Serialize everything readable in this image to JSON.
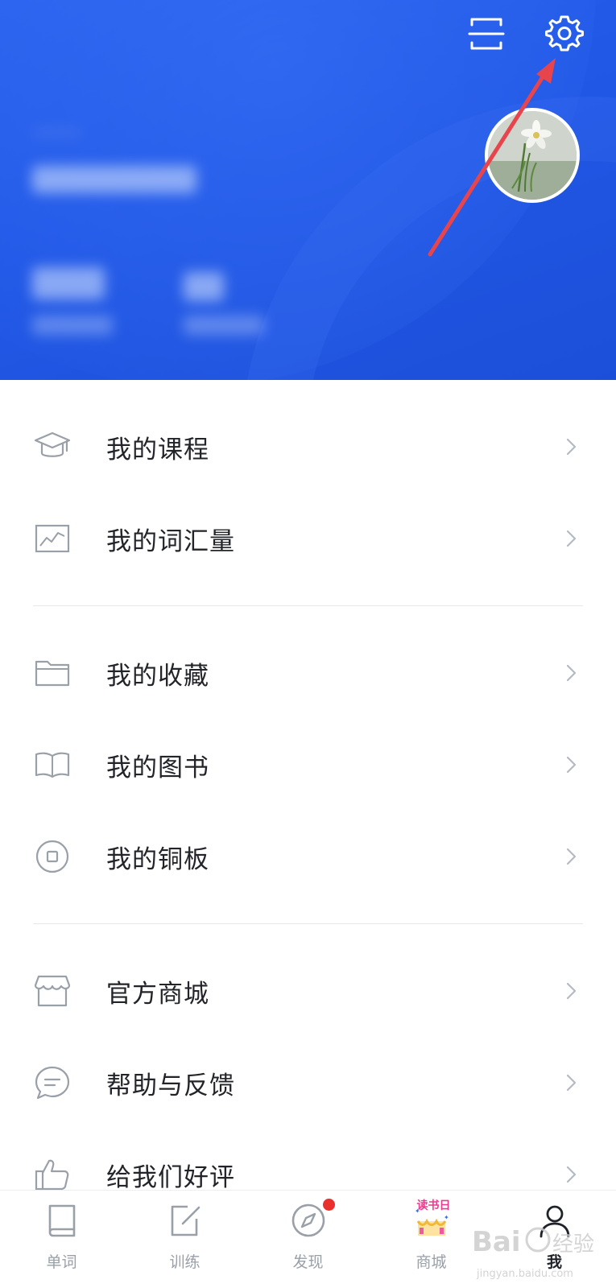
{
  "header": {
    "scan_icon": "scan-icon",
    "settings_icon": "settings-gear-icon",
    "user_name": "·····",
    "avatar_icon": "avatar-flower-photo"
  },
  "menu": {
    "groups": [
      {
        "items": [
          {
            "label": "我的课程",
            "icon": "graduation-cap-icon"
          },
          {
            "label": "我的词汇量",
            "icon": "chart-icon"
          }
        ]
      },
      {
        "items": [
          {
            "label": "我的收藏",
            "icon": "folder-icon"
          },
          {
            "label": "我的图书",
            "icon": "open-book-icon"
          },
          {
            "label": "我的铜板",
            "icon": "coin-icon"
          }
        ]
      },
      {
        "items": [
          {
            "label": "官方商城",
            "icon": "store-icon"
          },
          {
            "label": "帮助与反馈",
            "icon": "chat-bubble-icon"
          },
          {
            "label": "给我们好评",
            "icon": "thumbs-up-icon"
          }
        ]
      }
    ],
    "chevron_icon": "chevron-right-icon"
  },
  "tabbar": {
    "tabs": [
      {
        "label": "单词",
        "icon": "book-icon",
        "active": false
      },
      {
        "label": "训练",
        "icon": "edit-icon",
        "active": false
      },
      {
        "label": "发现",
        "icon": "compass-icon",
        "active": false,
        "badge": true
      },
      {
        "label": "商城",
        "icon": "reading-day-icon",
        "active": false,
        "promo_text": "读书日"
      },
      {
        "label": "我",
        "icon": "person-icon",
        "active": true
      }
    ]
  },
  "colors": {
    "header_blue": "#2158e6",
    "annotation_red": "#e8444c",
    "badge_red": "#e8312c",
    "icon_gray": "#9aa0a8",
    "text_dark": "#222429"
  },
  "watermark": {
    "text": "jingyan.baidu.com"
  }
}
